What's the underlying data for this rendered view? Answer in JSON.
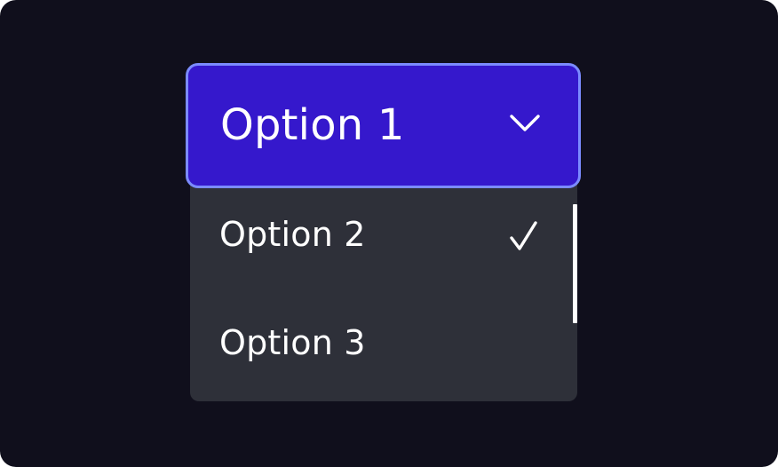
{
  "dropdown": {
    "selected_label": "Option 1",
    "expanded": true,
    "options": [
      {
        "label": "Option 2",
        "checked": true
      },
      {
        "label": "Option 3",
        "checked": false
      }
    ]
  },
  "icons": {
    "trigger": "chevron-down-icon",
    "checked_item": "checkmark-icon"
  },
  "colors": {
    "background": "#100f1c",
    "trigger_fill": "#3518cc",
    "trigger_border": "#7b8bff",
    "menu_fill": "#2e3039",
    "text": "#ffffff"
  }
}
